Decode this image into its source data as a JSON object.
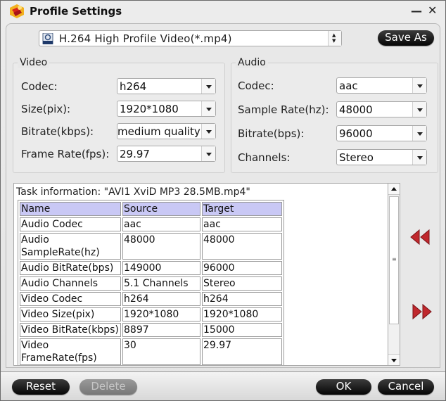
{
  "window": {
    "title": "Profile Settings",
    "app_icon": "app-logo-icon",
    "minimize_glyph": "—",
    "close_glyph": "✕"
  },
  "profile": {
    "selected": "H.264 High Profile Video(*.mp4)",
    "icon": "mp4-format-icon",
    "save_as_label": "Save As"
  },
  "video": {
    "title": "Video",
    "fields": [
      {
        "label": "Codec:",
        "value": "h264"
      },
      {
        "label": "Size(pix):",
        "value": "1920*1080"
      },
      {
        "label": "Bitrate(kbps):",
        "value": "medium quality"
      },
      {
        "label": "Frame Rate(fps):",
        "value": "29.97"
      }
    ]
  },
  "audio": {
    "title": "Audio",
    "fields": [
      {
        "label": "Codec:",
        "value": "aac"
      },
      {
        "label": "Sample Rate(hz):",
        "value": "48000"
      },
      {
        "label": "Bitrate(bps):",
        "value": "96000"
      },
      {
        "label": "Channels:",
        "value": "Stereo"
      }
    ]
  },
  "task_info": {
    "label": "Task information: \"AVI1 XviD MP3 28.5MB.mp4\"",
    "columns": [
      "Name",
      "Source",
      "Target"
    ],
    "rows": [
      [
        "Audio Codec",
        "aac",
        "aac"
      ],
      [
        "Audio SampleRate(hz)",
        "48000",
        "48000"
      ],
      [
        "Audio BitRate(bps)",
        "149000",
        "96000"
      ],
      [
        "Audio Channels",
        "5.1 Channels",
        "Stereo"
      ],
      [
        "Video Codec",
        "h264",
        "h264"
      ],
      [
        "Video Size(pix)",
        "1920*1080",
        "1920*1080"
      ],
      [
        "Video BitRate(kbps)",
        "8897",
        "15000"
      ],
      [
        "Video FrameRate(fps)",
        "30",
        "29.97"
      ]
    ]
  },
  "nav": {
    "prev_icon": "rewind-icon",
    "next_icon": "fast-forward-icon",
    "accent_color": "#c0282d"
  },
  "footer": {
    "reset_label": "Reset",
    "delete_label": "Delete",
    "ok_label": "OK",
    "cancel_label": "Cancel"
  }
}
